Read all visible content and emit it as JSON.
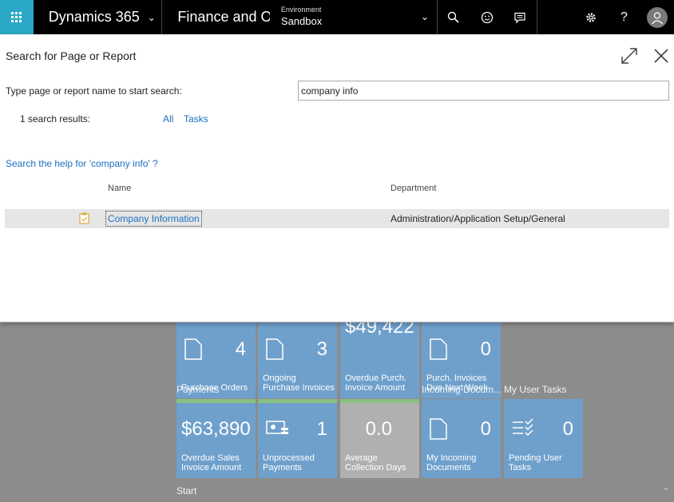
{
  "topbar": {
    "brand": "Dynamics 365",
    "app_title": "Finance and Operations",
    "environment_label": "Environment",
    "environment_value": "Sandbox"
  },
  "dialog": {
    "title": "Search for Page or Report",
    "prompt": "Type page or report name to start search:",
    "search_value": "company info",
    "results_count": "1 search results:",
    "filters": [
      "All",
      "Tasks"
    ],
    "help_link": "Search the help for 'company info' ?",
    "columns": {
      "name": "Name",
      "department": "Department"
    },
    "rows": [
      {
        "name": "Company Information",
        "department": "Administration/Application Setup/General",
        "icon": "task-icon"
      }
    ]
  },
  "workspace": {
    "tiles_top": [
      {
        "value": "4",
        "label": "Purchase Orders"
      },
      {
        "value": "3",
        "label": "Ongoing Purchase Invoices"
      },
      {
        "value": "$49,422",
        "label": "Overdue Purch. Invoice Amount"
      },
      {
        "value": "0",
        "label": "Purch. Invoices Due Next Week"
      }
    ],
    "sections": {
      "payments": "Payments",
      "incoming": "Incoming Docum...",
      "user_tasks": "My User Tasks",
      "start": "Start"
    },
    "tiles_bottom": [
      {
        "value": "$63,890",
        "label": "Overdue Sales Invoice Amount"
      },
      {
        "value": "1",
        "label": "Unprocessed Payments"
      },
      {
        "value": "0.0",
        "label": "Average Collection Days"
      },
      {
        "value": "0",
        "label": "My Incoming Documents"
      },
      {
        "value": "0",
        "label": "Pending User Tasks"
      }
    ]
  },
  "colors": {
    "accent": "#2aa8c5",
    "link": "#1b6fbf",
    "tile": "#6fa0cc",
    "tile_bar": "#8bc082"
  }
}
